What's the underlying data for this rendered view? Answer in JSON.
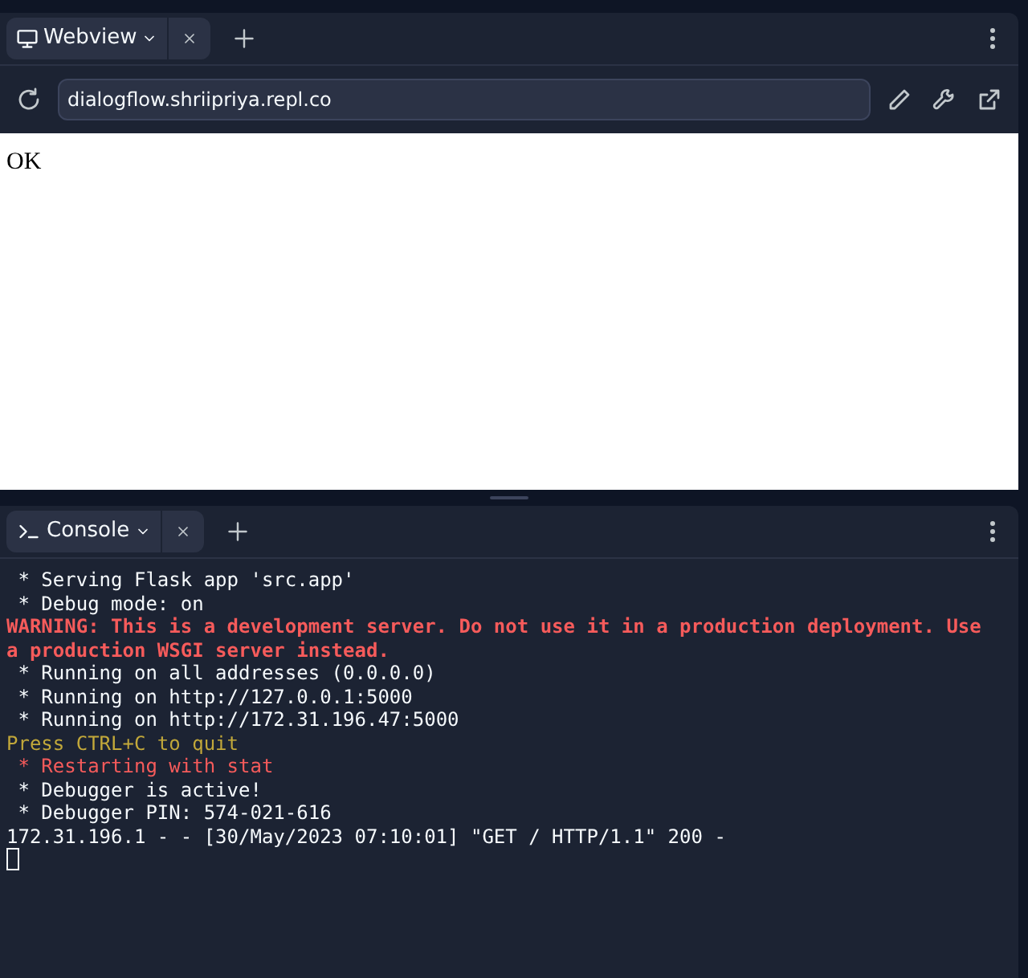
{
  "webview": {
    "tab": {
      "label": "Webview",
      "selected": true
    },
    "url": "dialogflow.shriipriya.repl.co",
    "content": "OK"
  },
  "console": {
    "tab": {
      "label": "Console",
      "selected": true
    },
    "lines": [
      {
        "kind": "normal",
        "text": " * Serving Flask app 'src.app'"
      },
      {
        "kind": "normal",
        "text": " * Debug mode: on"
      },
      {
        "kind": "warning",
        "text": "WARNING: This is a development server. Do not use it in a production deployment. Use a production WSGI server instead."
      },
      {
        "kind": "normal",
        "text": " * Running on all addresses (0.0.0.0)"
      },
      {
        "kind": "normal",
        "text": " * Running on http://127.0.0.1:5000"
      },
      {
        "kind": "normal",
        "text": " * Running on http://172.31.196.47:5000"
      },
      {
        "kind": "hint",
        "text": "Press CTRL+C to quit"
      },
      {
        "kind": "error",
        "text": " * Restarting with stat"
      },
      {
        "kind": "normal",
        "text": " * Debugger is active!"
      },
      {
        "kind": "normal",
        "text": " * Debugger PIN: 574-021-616"
      },
      {
        "kind": "normal",
        "text": "172.31.196.1 - - [30/May/2023 07:10:01] \"GET / HTTP/1.1\" 200 -"
      }
    ]
  }
}
